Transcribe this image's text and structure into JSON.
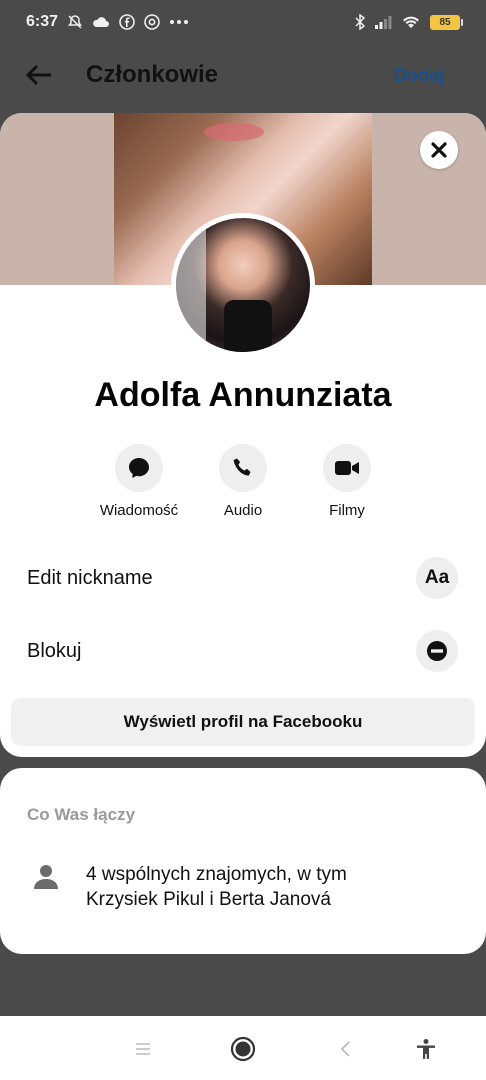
{
  "status_bar": {
    "time": "6:37",
    "battery": "85",
    "icons_left": [
      "mute-bell-icon",
      "cloud-icon",
      "facebook-icon",
      "chrome-icon",
      "more-dots-icon"
    ],
    "icons_right": [
      "bluetooth-icon",
      "signal-icon",
      "wifi-icon",
      "battery-icon"
    ]
  },
  "header": {
    "title": "Członkowie",
    "add_label": "Dodaj",
    "back_icon": "arrow-left-icon"
  },
  "profile": {
    "name": "Adolfa Annunziata",
    "close_icon": "close-icon"
  },
  "actions": [
    {
      "label": "Wiadomość",
      "icon": "message-bubble-icon"
    },
    {
      "label": "Audio",
      "icon": "phone-icon"
    },
    {
      "label": "Filmy",
      "icon": "video-camera-icon"
    }
  ],
  "options": [
    {
      "label": "Edit nickname",
      "icon_text": "Aa",
      "icon": "text-format-icon"
    },
    {
      "label": "Blokuj",
      "icon": "block-icon"
    }
  ],
  "facebook_button": "Wyświetl profil na Facebooku",
  "mutual": {
    "title": "Co Was łączy",
    "text": "4 wspólnych znajomych, w tym Krzysiek Pikul i Berta Janová",
    "icon": "person-icon"
  },
  "navbar": {
    "icons": [
      "menu-icon",
      "home-circle-icon",
      "back-chevron-icon",
      "accessibility-icon"
    ]
  },
  "colors": {
    "accent": "#1a4f8f",
    "overlay": "#4a4a4a",
    "surface": "#ffffff",
    "chip": "#eeeeee"
  }
}
